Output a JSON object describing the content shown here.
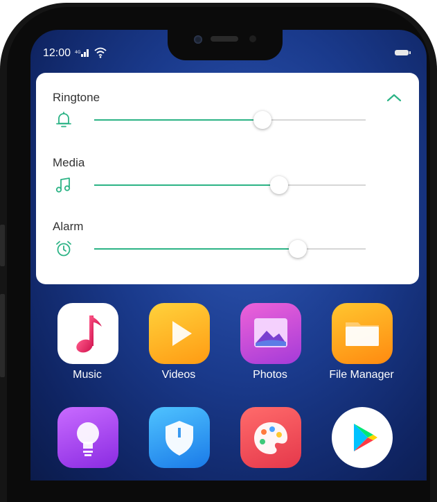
{
  "status_bar": {
    "time": "12:00",
    "signal_icon": "cellular-signal-icon",
    "wifi_icon": "wifi-icon",
    "battery_icon": "battery-icon"
  },
  "volume_panel": {
    "collapse_icon": "chevron-up-icon",
    "accent_color": "#2bb385",
    "sliders": [
      {
        "label": "Ringtone",
        "icon": "bell-icon",
        "level": 0.62
      },
      {
        "label": "Media",
        "icon": "music-note-icon",
        "level": 0.68
      },
      {
        "label": "Alarm",
        "icon": "alarm-clock-icon",
        "level": 0.75
      }
    ]
  },
  "home_screen": {
    "apps": [
      {
        "label": "Music",
        "icon": "music-icon"
      },
      {
        "label": "Videos",
        "icon": "play-icon"
      },
      {
        "label": "Photos",
        "icon": "photos-icon"
      },
      {
        "label": "File Manager",
        "icon": "folder-icon"
      },
      {
        "label": "",
        "icon": "lightbulb-icon"
      },
      {
        "label": "",
        "icon": "shield-icon"
      },
      {
        "label": "",
        "icon": "palette-icon"
      },
      {
        "label": "",
        "icon": "play-store-icon"
      }
    ]
  }
}
